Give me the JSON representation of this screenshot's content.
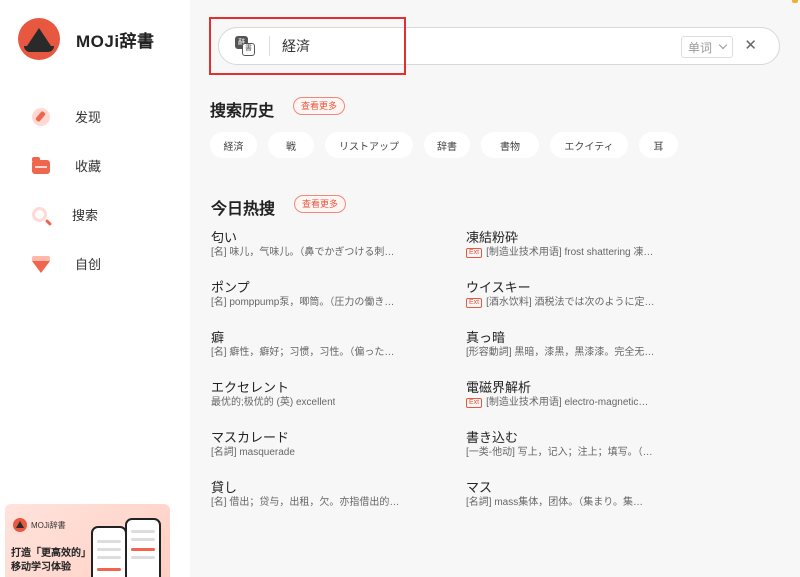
{
  "app": {
    "name": "MOJi辞書"
  },
  "sidebar": {
    "items": [
      {
        "label": "发现",
        "icon": "discover-icon"
      },
      {
        "label": "收藏",
        "icon": "favorites-icon"
      },
      {
        "label": "搜索",
        "icon": "search-icon"
      },
      {
        "label": "自创",
        "icon": "create-icon"
      }
    ],
    "promo": {
      "brand": "MOJi辞書",
      "line1": "打造「更高效的」",
      "line2": "移动学习体验"
    }
  },
  "search": {
    "value": "経済",
    "mode": "单词",
    "clear_icon": "close-icon"
  },
  "history": {
    "title": "搜索历史",
    "more": "查看更多",
    "items": [
      "経済",
      "戦",
      "リストアップ",
      "辞書",
      "書物",
      "エクイティ",
      "耳"
    ]
  },
  "hot": {
    "title": "今日热搜",
    "more": "查看更多",
    "items": [
      {
        "word": "匂い",
        "ext": false,
        "def": "[名] 味儿，气味儿。（鼻でかぎつける刺…"
      },
      {
        "word": "凍結粉砕",
        "ext": true,
        "ext_label": "Ext",
        "def": "[制造业技术用语] frost shattering 凍…"
      },
      {
        "word": "ポンプ",
        "ext": false,
        "def": "[名] pomppump泵，唧筒。（圧力の働き…"
      },
      {
        "word": "ウイスキー",
        "ext": true,
        "ext_label": "Ext",
        "def": "[酒水饮料] 酒税法では次のように定…"
      },
      {
        "word": "癖",
        "ext": false,
        "def": "[名] 癖性，癖好；习惯，习性。（偏った…"
      },
      {
        "word": "真っ暗",
        "ext": false,
        "def": "[形容動詞] 黑暗，漆黑，黑漆漆。完全无…"
      },
      {
        "word": "エクセレント",
        "ext": false,
        "def": "最优的;极优的 (英) excellent"
      },
      {
        "word": "電磁界解析",
        "ext": true,
        "ext_label": "Ext",
        "def": "[制造业技术用语] electro-magnetic…"
      },
      {
        "word": "マスカレード",
        "ext": false,
        "def": "[名詞] masquerade"
      },
      {
        "word": "書き込む",
        "ext": false,
        "def": "[一类-他动] 写上，记入；注上；填写。（…"
      },
      {
        "word": "貸し",
        "ext": false,
        "def": "[名] 借出；贷与，出租，欠。亦指借出的…"
      },
      {
        "word": "マス",
        "ext": false,
        "def": "[名詞] mass集体，团体。（集まり。集…"
      }
    ]
  },
  "colors": {
    "accent": "#e8573f",
    "highlight": "#e23030"
  }
}
